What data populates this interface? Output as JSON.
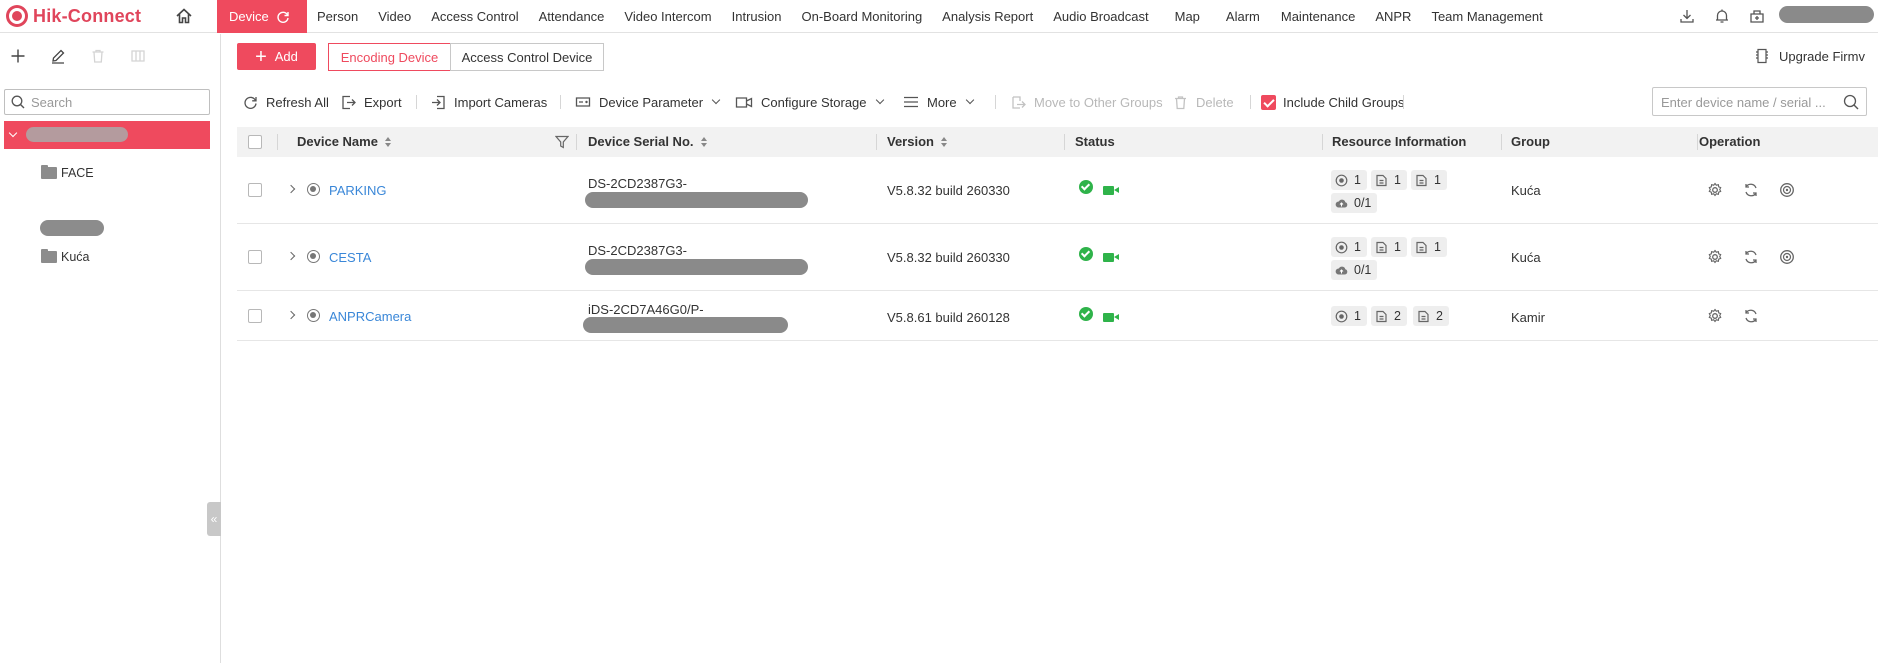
{
  "app": {
    "title": "Hik-Connect"
  },
  "nav": {
    "items": [
      "Device",
      "Person",
      "Video",
      "Access Control",
      "Attendance",
      "Video Intercom",
      "Intrusion",
      "On-Board Monitoring",
      "Analysis Report",
      "Audio Broadcast",
      "Map",
      "Alarm",
      "Maintenance",
      "ANPR",
      "Team Management"
    ],
    "active_index": 0
  },
  "sidebar": {
    "search_placeholder": "Search",
    "nodes": [
      {
        "label": "FACE"
      },
      {
        "label": "Kuća"
      }
    ]
  },
  "actions": {
    "add_label": "Add",
    "tabs": [
      "Encoding Device",
      "Access Control Device"
    ],
    "active_tab": 0,
    "upgrade_label": "Upgrade Firmv"
  },
  "toolbar": {
    "refresh_all": "Refresh All",
    "export": "Export",
    "import_cameras": "Import Cameras",
    "device_parameter": "Device Parameter",
    "configure_storage": "Configure Storage",
    "more": "More",
    "move_to_other_groups": "Move to Other Groups",
    "delete": "Delete",
    "include_child_groups": "Include Child Groups",
    "search_placeholder": "Enter device name / serial ..."
  },
  "table": {
    "columns": {
      "device_name": "Device Name",
      "serial": "Device Serial No.",
      "version": "Version",
      "status": "Status",
      "resource": "Resource Information",
      "group": "Group",
      "operation": "Operation"
    },
    "rows": [
      {
        "name": "PARKING",
        "serial": "DS-2CD2387G3-",
        "version": "V5.8.32 build 260330",
        "res": [
          "1",
          "1",
          "1"
        ],
        "storage": "0/1",
        "group": "Kuća"
      },
      {
        "name": "CESTA",
        "serial": "DS-2CD2387G3-",
        "version": "V5.8.32 build 260330",
        "res": [
          "1",
          "1",
          "1"
        ],
        "storage": "0/1",
        "group": "Kuća"
      },
      {
        "name": "ANPRCamera",
        "serial": "iDS-2CD7A46G0/P-",
        "version": "V5.8.61 build 260128",
        "res": [
          "1",
          "2",
          "2"
        ],
        "storage": "",
        "group": "Kamir"
      }
    ]
  },
  "colors": {
    "brand": "#ef4a5e",
    "link": "#3a87d8",
    "online": "#2fb34a"
  }
}
